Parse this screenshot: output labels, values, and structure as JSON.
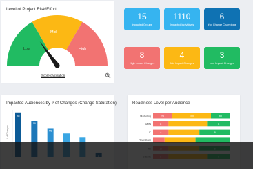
{
  "risk_card": {
    "title": "Level of Project Risk/Effort",
    "gauge": {
      "low_label": "Low",
      "mid_label": "Mid",
      "high_label": "High",
      "low_color": "#21bb62",
      "mid_color": "#fcb814",
      "high_color": "#f27372",
      "needle_level": 0.3
    },
    "score_link": "Score calculation",
    "zoom_icon": "magnify-icon"
  },
  "kpi_tiles": [
    {
      "value": "15",
      "label": "Impacted Groups",
      "color": "#36b4f0"
    },
    {
      "value": "1110",
      "label": "Impacted Individuals",
      "color": "#36b4f0"
    },
    {
      "value": "6",
      "label": "# of Change Champions",
      "color": "#0f72b3"
    },
    {
      "value": "8",
      "label": "High Impact Changes",
      "color": "#f27372"
    },
    {
      "value": "4",
      "label": "Mid Impact Changes",
      "color": "#fcb814"
    },
    {
      "value": "3",
      "label": "Low Impact Changes",
      "color": "#21bb62"
    }
  ],
  "audiences_card": {
    "title": "Impacted Audiences by # of Changes (Change Saturation)"
  },
  "readiness_card": {
    "title": "Readiness Level per Audience"
  },
  "chart_data": [
    {
      "type": "bar",
      "title": "Impacted Audiences by # of Changes (Change Saturation)",
      "ylabel": "# of Changes",
      "categories": [
        "",
        "",
        "",
        "",
        "",
        ""
      ],
      "values": [
        85,
        70,
        55,
        46,
        38,
        8
      ],
      "value_labels": [
        "85",
        "70",
        "55",
        "",
        "",
        "8"
      ],
      "colors": [
        "#0d5b97",
        "#1c77b8",
        "#2b8fd1",
        "#3aa6e3",
        "#3aa6e3",
        "#0d5b97"
      ],
      "ylim": [
        0,
        90
      ]
    },
    {
      "type": "bar",
      "orientation": "horizontal",
      "stacked": true,
      "title": "Readiness Level per Audience",
      "categories": [
        "Marketing",
        "Sales",
        "IT",
        "Operations",
        "HR",
        "C-Suite"
      ],
      "series": [
        {
          "color": "#f27372",
          "values": [
            25,
            20,
            20,
            15,
            20,
            20
          ],
          "labels": [
            "25",
            "8",
            "4",
            "",
            "10",
            "8"
          ]
        },
        {
          "color": "#fcb814",
          "values": [
            50,
            50,
            40,
            40,
            40,
            50
          ],
          "labels": [
            "100",
            "",
            "",
            "",
            "",
            ""
          ]
        },
        {
          "color": "#21bb62",
          "values": [
            25,
            30,
            40,
            45,
            40,
            30
          ],
          "labels": [
            "60",
            "8",
            "8",
            "",
            "8",
            "8"
          ]
        }
      ],
      "xlim": [
        0,
        100
      ]
    }
  ]
}
